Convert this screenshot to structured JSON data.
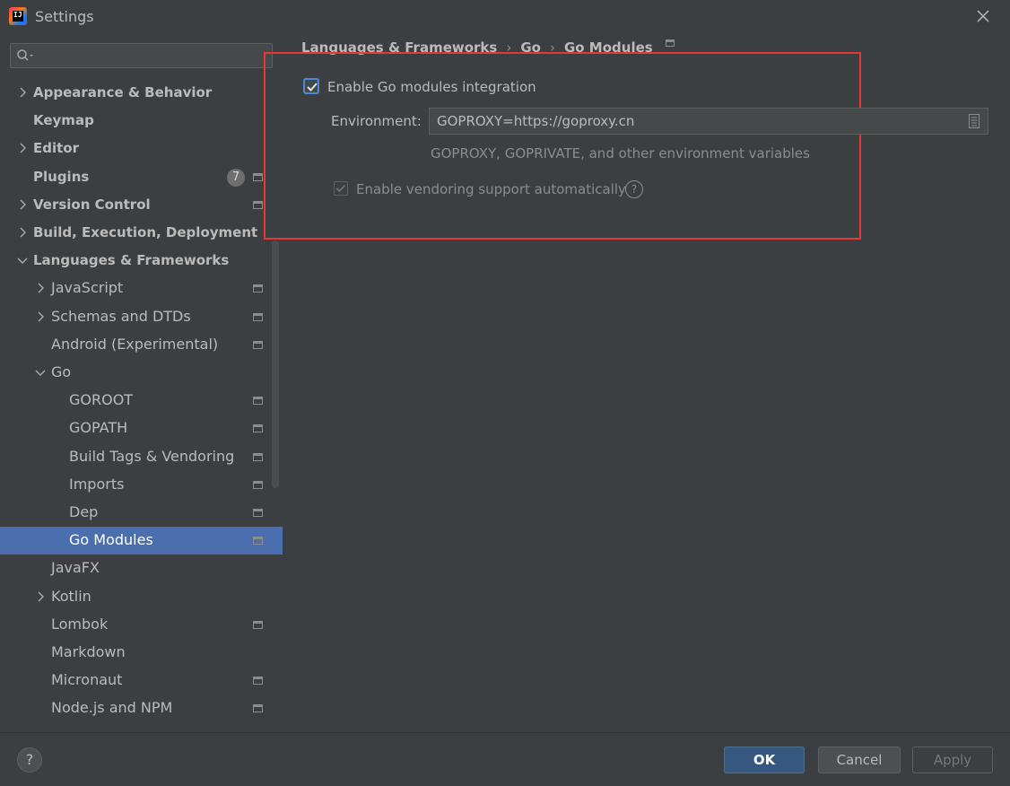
{
  "window": {
    "title": "Settings",
    "logo_text": "IJ"
  },
  "search": {
    "value": "",
    "placeholder": ""
  },
  "sidebar": {
    "items": [
      {
        "label": "Appearance & Behavior",
        "bold": true,
        "chevron": "right",
        "level": 0,
        "settings_icon": false
      },
      {
        "label": "Keymap",
        "bold": true,
        "chevron": "none",
        "level": 0,
        "settings_icon": false
      },
      {
        "label": "Editor",
        "bold": true,
        "chevron": "right",
        "level": 0,
        "settings_icon": false
      },
      {
        "label": "Plugins",
        "bold": true,
        "chevron": "none",
        "level": 0,
        "settings_icon": true,
        "badge": "7"
      },
      {
        "label": "Version Control",
        "bold": true,
        "chevron": "right",
        "level": 0,
        "settings_icon": true
      },
      {
        "label": "Build, Execution, Deployment",
        "bold": true,
        "chevron": "right",
        "level": 0,
        "settings_icon": false
      },
      {
        "label": "Languages & Frameworks",
        "bold": true,
        "chevron": "down",
        "level": 0,
        "settings_icon": false
      },
      {
        "label": "JavaScript",
        "bold": false,
        "chevron": "right",
        "level": 1,
        "settings_icon": true
      },
      {
        "label": "Schemas and DTDs",
        "bold": false,
        "chevron": "right",
        "level": 1,
        "settings_icon": true
      },
      {
        "label": "Android (Experimental)",
        "bold": false,
        "chevron": "none",
        "level": 1,
        "settings_icon": true
      },
      {
        "label": "Go",
        "bold": false,
        "chevron": "down",
        "level": 1,
        "settings_icon": false
      },
      {
        "label": "GOROOT",
        "bold": false,
        "chevron": "none",
        "level": 2,
        "settings_icon": true
      },
      {
        "label": "GOPATH",
        "bold": false,
        "chevron": "none",
        "level": 2,
        "settings_icon": true
      },
      {
        "label": "Build Tags & Vendoring",
        "bold": false,
        "chevron": "none",
        "level": 2,
        "settings_icon": true
      },
      {
        "label": "Imports",
        "bold": false,
        "chevron": "none",
        "level": 2,
        "settings_icon": true
      },
      {
        "label": "Dep",
        "bold": false,
        "chevron": "none",
        "level": 2,
        "settings_icon": true
      },
      {
        "label": "Go Modules",
        "bold": false,
        "chevron": "none",
        "level": 2,
        "settings_icon": true,
        "selected": true
      },
      {
        "label": "JavaFX",
        "bold": false,
        "chevron": "none",
        "level": 1,
        "settings_icon": false
      },
      {
        "label": "Kotlin",
        "bold": false,
        "chevron": "right",
        "level": 1,
        "settings_icon": false
      },
      {
        "label": "Lombok",
        "bold": false,
        "chevron": "none",
        "level": 1,
        "settings_icon": true
      },
      {
        "label": "Markdown",
        "bold": false,
        "chevron": "none",
        "level": 1,
        "settings_icon": false
      },
      {
        "label": "Micronaut",
        "bold": false,
        "chevron": "none",
        "level": 1,
        "settings_icon": true
      },
      {
        "label": "Node.js and NPM",
        "bold": false,
        "chevron": "none",
        "level": 1,
        "settings_icon": true
      }
    ]
  },
  "breadcrumb": {
    "items": [
      "Languages & Frameworks",
      "Go",
      "Go Modules"
    ],
    "separator": "›"
  },
  "content": {
    "enable_modules": {
      "label": "Enable Go modules integration",
      "checked": true
    },
    "environment": {
      "label": "Environment:",
      "value": "GOPROXY=https://goproxy.cn",
      "hint": "GOPROXY, GOPRIVATE, and other environment variables"
    },
    "vendoring": {
      "label": "Enable vendoring support automatically",
      "checked": true,
      "enabled": false
    }
  },
  "footer": {
    "help_label": "?",
    "ok_label": "OK",
    "cancel_label": "Cancel",
    "apply_label": "Apply"
  },
  "colors": {
    "background": "#3c3f41",
    "selection": "#4b6eaf",
    "accent_button": "#365880",
    "highlight_frame": "#e53935",
    "text": "#bbbbbb",
    "muted_text": "#8c8c8c"
  }
}
